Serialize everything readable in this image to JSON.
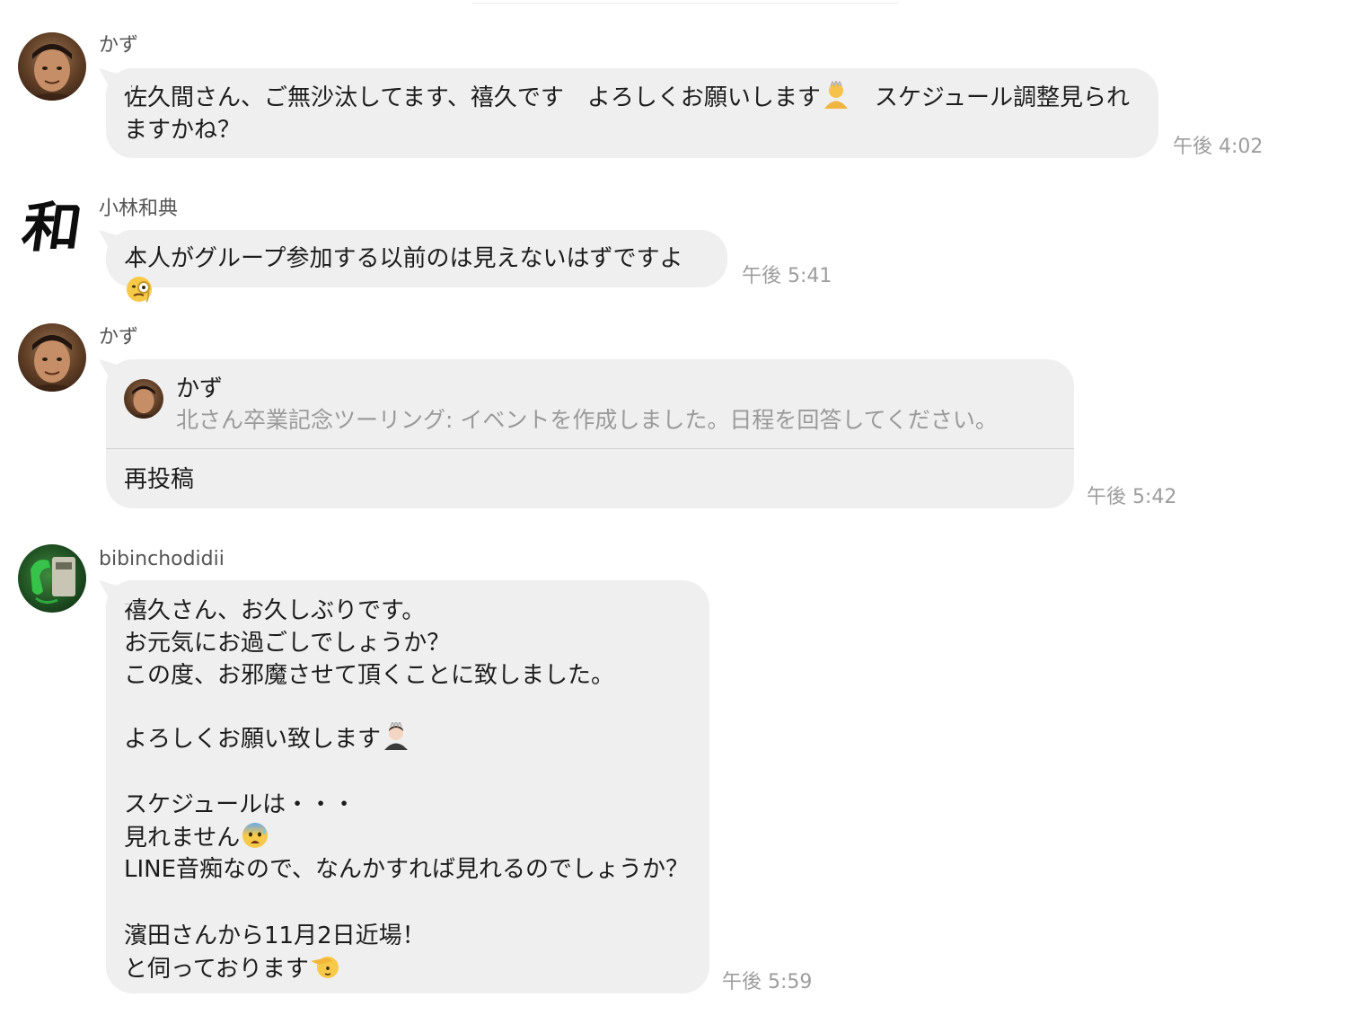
{
  "messages": [
    {
      "sender": "かず",
      "text_before": "佐久間さん、ご無沙汰してます、禧久です　よろしくお願いします",
      "text_after": "　スケジュール調整見られますかね？",
      "time": "午後 4:02",
      "emoji": "person-bowing-emoji"
    },
    {
      "sender": "小林和典",
      "avatar_text": "和",
      "text": "本人がグループ参加する以前のは見えないはずですよ",
      "time": "午後 5:41",
      "emoji": "face-with-monocle-emoji"
    },
    {
      "sender": "かず",
      "quote": {
        "name": "かず",
        "body": "北さん卒業記念ツーリング: イベントを作成しました。日程を回答してください。"
      },
      "action": "再投稿",
      "time": "午後 5:42"
    },
    {
      "sender": "bibinchodidii",
      "lines": [
        "禧久さん、お久しぶりです。",
        "お元気にお過ごしでしょうか？",
        "この度、お邪魔させて頂くことに致しました。",
        "よろしくお願い致します",
        "スケジュールは・・・",
        "見れません",
        "LINE音痴なので、なんかすれば見れるのでしょうか？",
        "濱田さんから11月2日近場！",
        "と伺っております"
      ],
      "time": "午後 5:59",
      "emojis": [
        "person-bowing-emoji",
        "anxious-face-with-sweat-emoji",
        "saluting-face-emoji"
      ]
    }
  ],
  "colors": {
    "bubble": "#efefef",
    "time": "#9d9d9d",
    "sender": "#555555",
    "quote_body": "#9a9a9a"
  }
}
